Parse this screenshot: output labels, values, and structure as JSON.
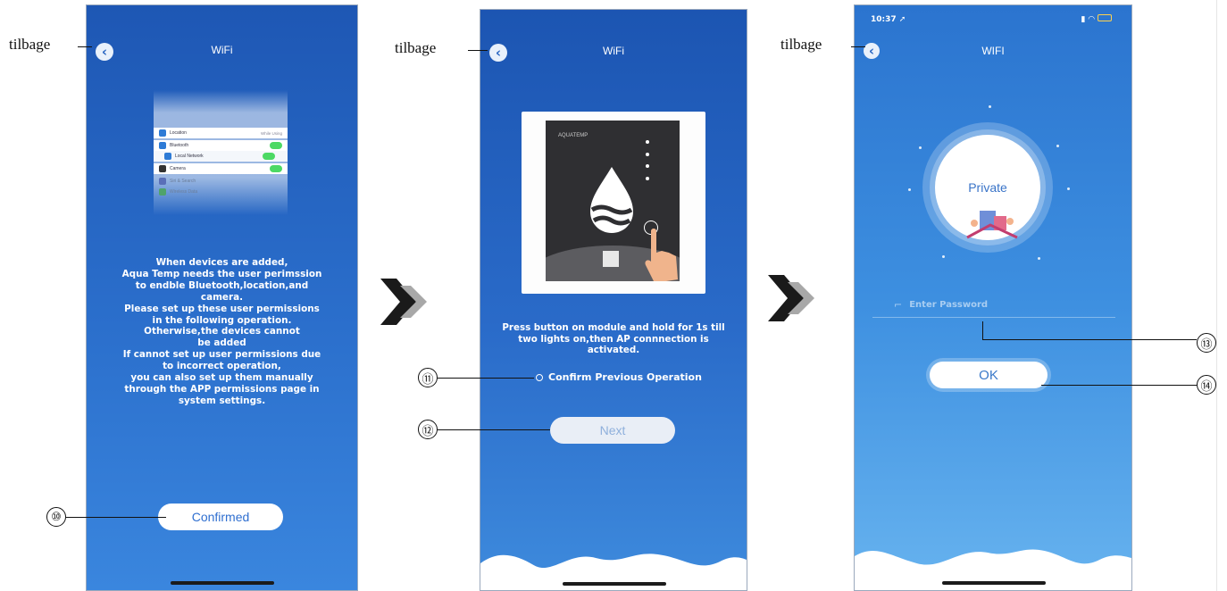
{
  "labels": {
    "back_label": "tilbage"
  },
  "screen1": {
    "title": "WiFi",
    "permission_rows": [
      {
        "label": "Location",
        "right": "While Using"
      },
      {
        "label": "Bluetooth"
      },
      {
        "label": "Local Network"
      },
      {
        "label": "Camera"
      },
      {
        "label": "Siri & Search"
      },
      {
        "label": "Wireless Data"
      }
    ],
    "body": "When devices are added,\nAqua Temp needs the user perimssion\nto endble Bluetooth,location,and\ncamera.\nPlease set up these user permissions\nin the following operation.\nOtherwise,the devices cannot\nbe added\nIf cannot set up user permissions due\nto incorrect operation,\nyou can also set up them manually\nthrough the APP permissions page in\nsystem settings.",
    "confirm_button": "Confirmed",
    "callout": "⑩"
  },
  "screen2": {
    "title": "WiFi",
    "brand": "AQUATEMP",
    "instruction": "Press button on module and hold for 1s till\ntwo lights on,then AP connnection is\nactivated.",
    "confirm_previous": "Confirm Previous Operation",
    "next_button": "Next",
    "callout_confirm": "⑪",
    "callout_next": "⑫"
  },
  "screen3": {
    "status_time": "10:37",
    "title": "WIFI",
    "network_name": "Private",
    "password_placeholder": "Enter Password",
    "ok_button": "OK",
    "callout_password": "⑬",
    "callout_ok": "⑭"
  },
  "colors": {
    "arrow_dark": "#1a1a1a",
    "arrow_light": "#a8a8a8",
    "button_text_blue": "#2f6fd0",
    "next_disabled_text": "#8fb0dc",
    "ok_text": "#3a79c9"
  }
}
